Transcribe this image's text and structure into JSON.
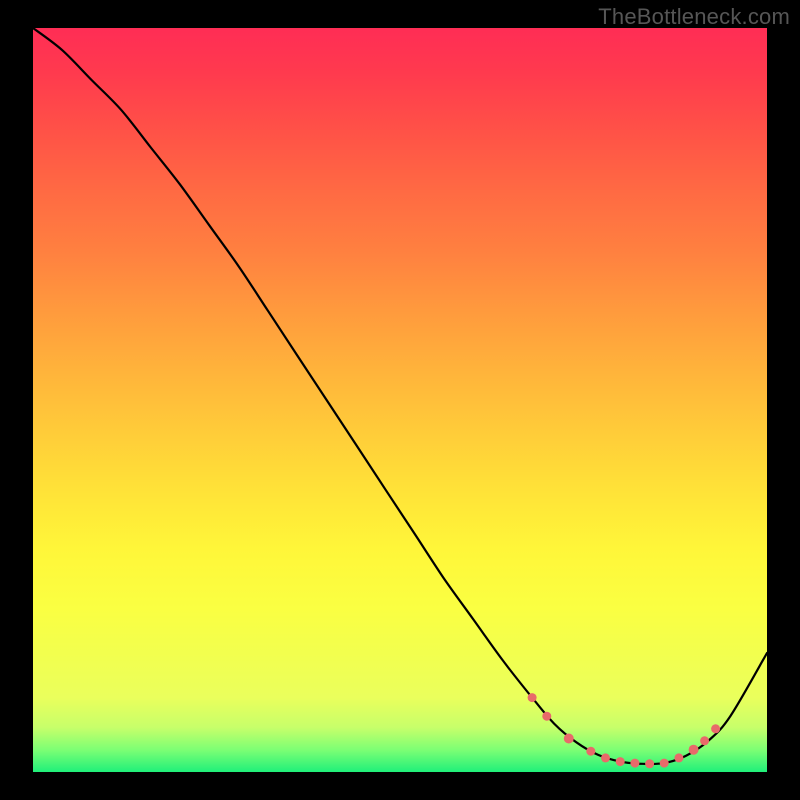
{
  "watermark": "TheBottleneck.com",
  "colors": {
    "curve": "#000000",
    "marker": "#e86a6a"
  },
  "chart_data": {
    "type": "line",
    "title": "",
    "xlabel": "",
    "ylabel": "",
    "xlim": [
      0,
      100
    ],
    "ylim": [
      0,
      100
    ],
    "grid": false,
    "legend": false,
    "series": [
      {
        "name": "bottleneck-curve",
        "x": [
          0,
          4,
          8,
          12,
          16,
          20,
          24,
          28,
          32,
          36,
          40,
          44,
          48,
          52,
          56,
          60,
          64,
          68,
          71,
          74,
          77,
          80,
          83,
          86,
          89,
          92,
          95,
          100
        ],
        "y": [
          100,
          97,
          93,
          89,
          84,
          79,
          73.5,
          68,
          62,
          56,
          50,
          44,
          38,
          32,
          26,
          20.5,
          15,
          10,
          6.5,
          4,
          2.3,
          1.4,
          1.1,
          1.2,
          2.2,
          4.2,
          7.5,
          16
        ]
      }
    ],
    "markers": {
      "name": "optimal-zone",
      "color": "#e86a6a",
      "points": [
        {
          "x": 68,
          "y": 10,
          "r": 4.5
        },
        {
          "x": 70,
          "y": 7.5,
          "r": 4.5
        },
        {
          "x": 73,
          "y": 4.5,
          "r": 5.0
        },
        {
          "x": 76,
          "y": 2.8,
          "r": 4.5
        },
        {
          "x": 78,
          "y": 1.9,
          "r": 4.5
        },
        {
          "x": 80,
          "y": 1.4,
          "r": 4.5
        },
        {
          "x": 82,
          "y": 1.2,
          "r": 4.5
        },
        {
          "x": 84,
          "y": 1.1,
          "r": 4.5
        },
        {
          "x": 86,
          "y": 1.2,
          "r": 4.5
        },
        {
          "x": 88,
          "y": 1.9,
          "r": 4.5
        },
        {
          "x": 90,
          "y": 3.0,
          "r": 5.0
        },
        {
          "x": 91.5,
          "y": 4.2,
          "r": 4.5
        },
        {
          "x": 93,
          "y": 5.8,
          "r": 4.5
        }
      ]
    }
  }
}
